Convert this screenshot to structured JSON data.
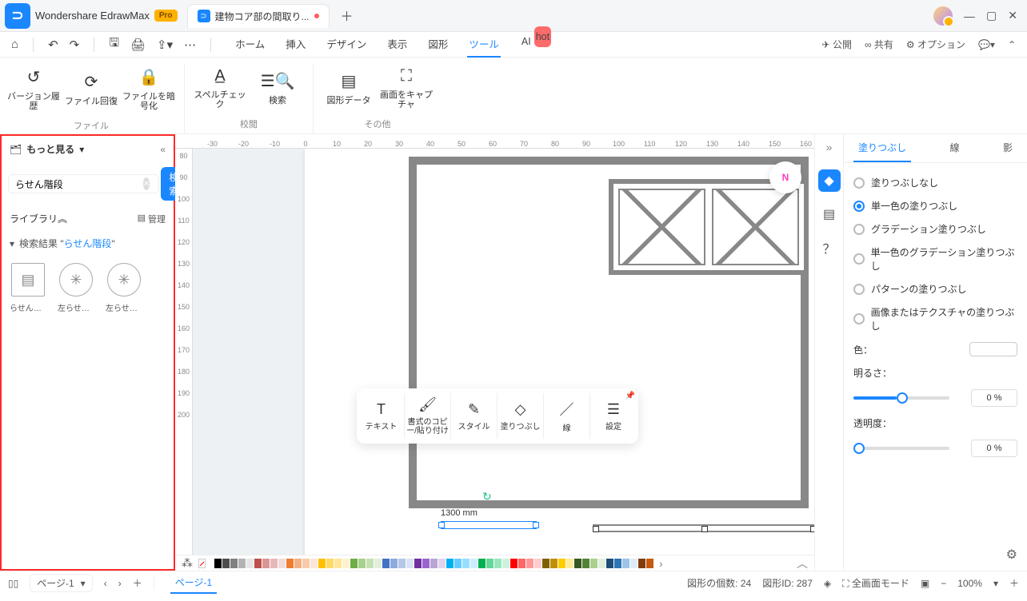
{
  "app": {
    "name": "Wondershare EdrawMax",
    "pro": "Pro"
  },
  "doc_tab": {
    "title": "建物コア部の間取り..."
  },
  "menu": {
    "home": "ホーム",
    "insert": "挿入",
    "design": "デザイン",
    "view": "表示",
    "shape": "図形",
    "tool": "ツール",
    "ai": "AI",
    "hot": "hot"
  },
  "top_actions": {
    "publish": "公開",
    "share": "共有",
    "options": "オプション"
  },
  "ribbon": {
    "file_group": "ファイル",
    "review_group": "校閲",
    "other_group": "その他",
    "history": "バージョン履歴",
    "recover": "ファイル回復",
    "encrypt": "ファイルを暗号化",
    "spell": "スペルチェック",
    "search": "検索",
    "shapedata": "図形データ",
    "capture": "画面をキャプチャ"
  },
  "sidepane": {
    "more": "もっと見る",
    "search_value": "らせん階段",
    "search_btn": "検索",
    "library": "ライブラリ",
    "manage": "管理",
    "results_prefix": "検索結果 \"",
    "results_kw": "らせん階段",
    "results_suffix": "\"",
    "s1": "らせん階…",
    "s2": "左らせん…",
    "s3": "左らせん…"
  },
  "ruler_h": [
    "-30",
    "-20",
    "-10",
    "0",
    "10",
    "20",
    "30",
    "40",
    "50",
    "60",
    "70",
    "80",
    "90",
    "100",
    "110",
    "120",
    "130",
    "140",
    "150",
    "160"
  ],
  "ruler_v": [
    "80",
    "90",
    "100",
    "110",
    "120",
    "130",
    "140",
    "150",
    "160",
    "170",
    "180",
    "190",
    "200"
  ],
  "float": {
    "text": "テキスト",
    "format": "書式のコピー/貼り付け",
    "style": "スタイル",
    "fill": "塗りつぶし",
    "line": "線",
    "set": "設定"
  },
  "dim": "1300 mm",
  "prop": {
    "tab_fill": "塗りつぶし",
    "tab_line": "線",
    "tab_shadow": "影",
    "r_none": "塗りつぶしなし",
    "r_solid": "単一色の塗りつぶし",
    "r_grad": "グラデーション塗りつぶし",
    "r_sgrad": "単一色のグラデーション塗りつぶし",
    "r_pattern": "パターンの塗りつぶし",
    "r_image": "画像またはテクスチャの塗りつぶし",
    "color": "色：",
    "brightness": "明るさ：",
    "opacity": "透明度：",
    "pct0": "0 %"
  },
  "status": {
    "page_sel": "ページ-1",
    "page_tab": "ページ-1",
    "count_label": "図形の個数:",
    "count": "24",
    "id_label": "図形ID:",
    "id": "287",
    "full": "全画面モード",
    "zoom": "100%"
  },
  "colors": [
    "#fff",
    "#000",
    "#4d4d4d",
    "#808080",
    "#b3b3b3",
    "#e6e6e6",
    "#c0504d",
    "#d99694",
    "#e6b9b8",
    "#f2dcdb",
    "#ed7d31",
    "#f4b183",
    "#f8cbad",
    "#fbe5d6",
    "#ffc000",
    "#ffd966",
    "#ffe699",
    "#fff2cc",
    "#70ad47",
    "#a9d18e",
    "#c5e0b4",
    "#e2f0d9",
    "#4472c4",
    "#8faadc",
    "#b4c7e7",
    "#dae3f3",
    "#7030a0",
    "#9966cc",
    "#b9a6d4",
    "#e0d5ec",
    "#00b0f0",
    "#66ccff",
    "#99ddff",
    "#cceeff",
    "#00b050",
    "#66d699",
    "#99e6bb",
    "#ccf2dd",
    "#ff0000",
    "#ff6666",
    "#ff9999",
    "#ffcccc",
    "#7f6000",
    "#bf9000",
    "#ffcc00",
    "#ffeb99",
    "#385723",
    "#548235",
    "#a9d08e",
    "#e2efda",
    "#1f4e79",
    "#2e75b6",
    "#9dc3e6",
    "#deebf7",
    "#833c0c",
    "#c55a11"
  ]
}
